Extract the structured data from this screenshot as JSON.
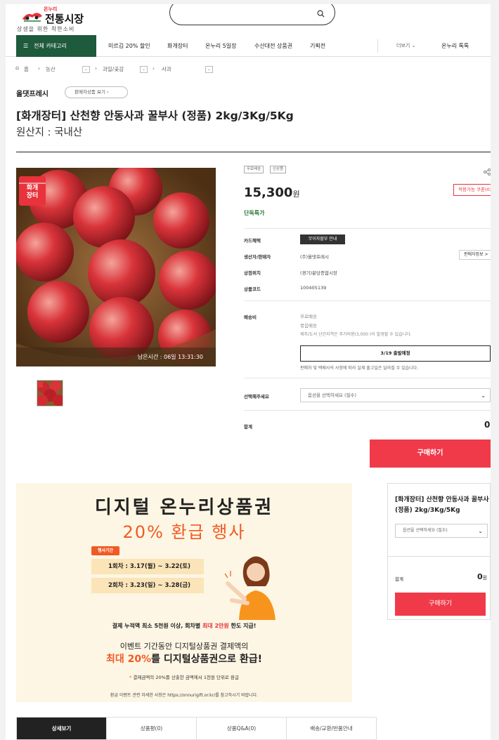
{
  "header": {
    "logo_kicker": "온누리",
    "logo_title": "전통시장",
    "logo_sub": "상생을 위한 착한소비",
    "search_placeholder": ""
  },
  "nav": {
    "all_categories": "전체 카테고리",
    "items": [
      "미르김 20% 할인",
      "화개장터",
      "온누리 5일장",
      "수산대전 상품권",
      "기획전"
    ],
    "more": "더보기",
    "talk": "온누리 톡톡"
  },
  "breadcrumb": [
    "홈",
    "농산",
    "과일/곶감",
    "사과"
  ],
  "seller": {
    "name": "올댓프레시",
    "view_products": "판매자상품 보기"
  },
  "product": {
    "title": "[화개장터] 산천향 안동사과 꿀부사 (정품) 2kg/3Kg/5Kg",
    "origin": "원산지 : 국내산",
    "image_badge": "화개\n장터",
    "timer": "남은시간 : 06일 13:31:30",
    "tags": [
      "무료배송",
      "신상품"
    ],
    "price": "15,300",
    "price_unit": "원",
    "coupon": "적용가능 쿠폰(0)",
    "deal": "단독특가",
    "rows": {
      "card_label": "카드혜택",
      "card_btn": "무이자할부 안내",
      "producer_label": "생산자/판매자",
      "producer_val": "(주)올댓프레시",
      "seller_info_btn": "판매자정보 >",
      "market_label": "상점위치",
      "market_val": "(경기)분당종합시장",
      "code_label": "상품코드",
      "code_val": "100405139",
      "ship_label": "배송비",
      "ship_1": "무료배송",
      "ship_2": "묶음배송",
      "ship_3": "제주/도서 산간지역은 추가비용(3,000 )이 발생할 수 있습니다.",
      "ship_box": "3/19 출발예정",
      "ship_note": "판매처 및 택배사의 사정에 따라 실제 출고일은 달라질 수 있습니다.",
      "option_label": "선택해주세요",
      "option_placeholder": "옵션을 선택하세요 (필수)",
      "total_label": "합계",
      "total_val": "0"
    },
    "buy": "구매하기"
  },
  "banner": {
    "title1": "디지털 온누리상품권",
    "title2": "20% 환급 행사",
    "badge": "행사기간",
    "round1_label": "1회차 : ",
    "round1_val": "3.17(월) ~ 3.22(토)",
    "round2_label": "2회차 : ",
    "round2_val": "3.23(일) ~ 3.28(금)",
    "line1_a": "결제 누적액 최소 5천원 이상, 회차별 ",
    "line1_b": "최대 2만원",
    "line1_c": " 한도 지급!",
    "line2": "이벤트 기간동안 디지털상품권 결제액의",
    "line3_a": "최대 20%",
    "line3_b": "를 디지털상품권으로 환급!",
    "line4_star": "*",
    "line4": " 결제금액의 20%를 산출한 금액에서 1천원 단위로 환급",
    "line5": "환급 이벤트 관련 자세한 사항은 https://onnurigift.or.kr/를 참고하시기 바랍니다."
  },
  "side_panel": {
    "title": "[화개장터] 산천향 안동사과 꿀부사 (정품) 2kg/3Kg/5Kg",
    "option_placeholder": "옵션을 선택하세요 (필수)",
    "total_label": "합계",
    "total_val": "0",
    "total_unit": "원",
    "buy": "구매하기"
  },
  "tabs": [
    "상세보기",
    "상품평(0)",
    "상품Q&A(0)",
    "배송/교환/반품안내"
  ],
  "colors": {
    "brand_green": "#1e5a3c",
    "buy_red": "#f03a4a",
    "accent_orange": "#f15a23"
  }
}
